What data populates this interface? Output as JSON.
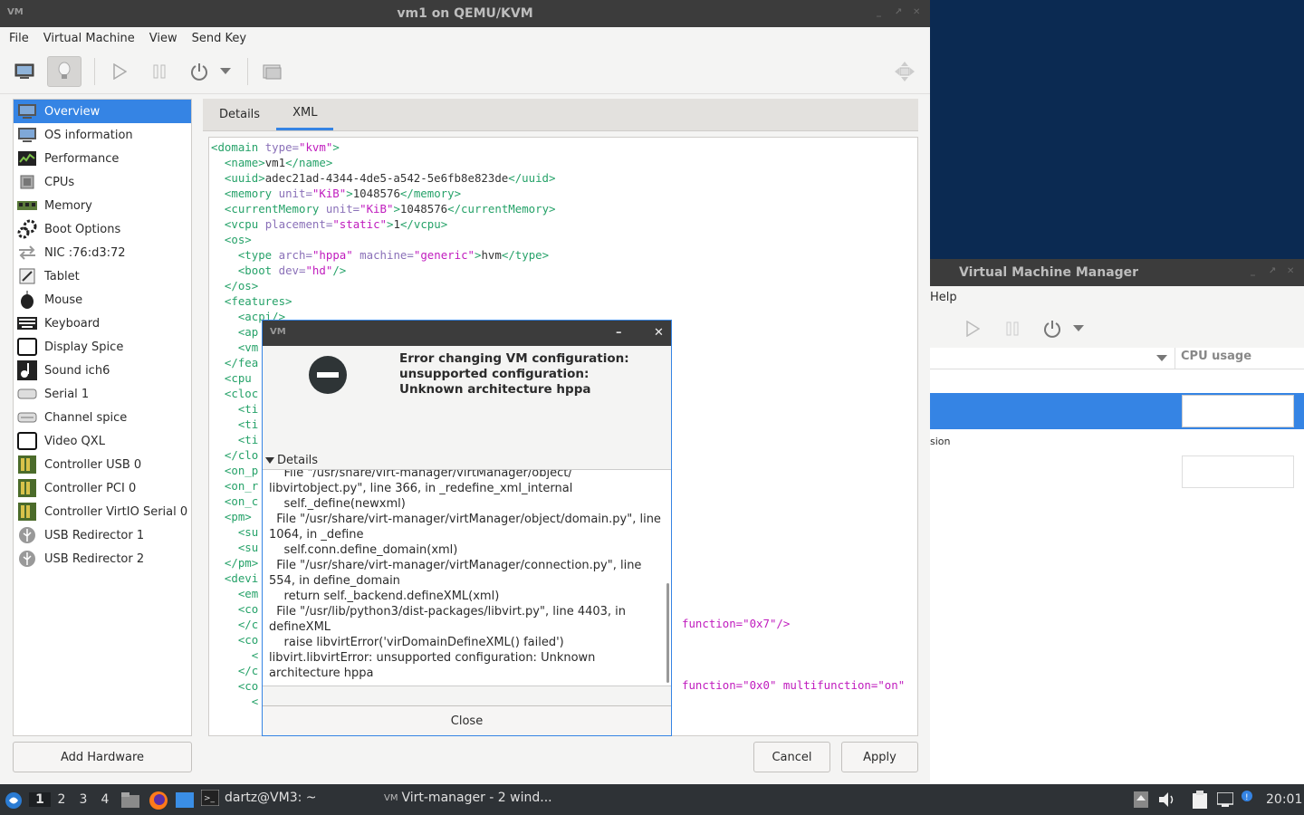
{
  "main_window": {
    "title": "vm1 on QEMU/KVM",
    "menu": [
      "File",
      "Virtual Machine",
      "View",
      "Send Key"
    ],
    "sidebar_items": [
      {
        "label": "Overview",
        "icon": "monitor-icon"
      },
      {
        "label": "OS information",
        "icon": "monitor-icon"
      },
      {
        "label": "Performance",
        "icon": "chart-icon"
      },
      {
        "label": "CPUs",
        "icon": "cpu-icon"
      },
      {
        "label": "Memory",
        "icon": "memory-icon"
      },
      {
        "label": "Boot Options",
        "icon": "gears-icon"
      },
      {
        "label": "NIC :76:d3:72",
        "icon": "network-arrows-icon"
      },
      {
        "label": "Tablet",
        "icon": "tablet-icon"
      },
      {
        "label": "Mouse",
        "icon": "mouse-icon"
      },
      {
        "label": "Keyboard",
        "icon": "keyboard-icon"
      },
      {
        "label": "Display Spice",
        "icon": "display-icon"
      },
      {
        "label": "Sound ich6",
        "icon": "sound-icon"
      },
      {
        "label": "Serial 1",
        "icon": "serial-icon"
      },
      {
        "label": "Channel spice",
        "icon": "channel-icon"
      },
      {
        "label": "Video QXL",
        "icon": "video-icon"
      },
      {
        "label": "Controller USB 0",
        "icon": "controller-icon"
      },
      {
        "label": "Controller PCI 0",
        "icon": "controller-icon"
      },
      {
        "label": "Controller VirtIO Serial 0",
        "icon": "controller-icon"
      },
      {
        "label": "USB Redirector 1",
        "icon": "usb-icon"
      },
      {
        "label": "USB Redirector 2",
        "icon": "usb-icon"
      }
    ],
    "add_hardware": "Add Hardware",
    "tabs": [
      "Details",
      "XML"
    ],
    "cancel": "Cancel",
    "apply": "Apply",
    "xml_right_1": "function=\"0x7\"/>",
    "xml_right_2": "function=\"0x0\" multifunction=\"on\""
  },
  "dialog": {
    "message": "Error changing VM configuration: unsupported configuration: Unknown architecture hppa",
    "details_label": "Details",
    "traceback": [
      "    File \"/usr/share/virt-manager/virtManager/object/",
      "libvirtobject.py\", line 366, in _redefine_xml_internal",
      "    self._define(newxml)",
      "  File \"/usr/share/virt-manager/virtManager/object/domain.py\", line",
      "1064, in _define",
      "    self.conn.define_domain(xml)",
      "  File \"/usr/share/virt-manager/virtManager/connection.py\", line",
      "554, in define_domain",
      "    return self._backend.defineXML(xml)",
      "  File \"/usr/lib/python3/dist-packages/libvirt.py\", line 4403, in",
      "defineXML",
      "    raise libvirtError('virDomainDefineXML() failed')",
      "libvirt.libvirtError: unsupported configuration: Unknown",
      "architecture hppa"
    ],
    "close": "Close"
  },
  "manager_window": {
    "title": "Virtual Machine Manager",
    "menu_help": "Help",
    "cpu_usage": "CPU usage",
    "row_text": "sion"
  },
  "taskbar": {
    "workspaces": [
      "1",
      "2",
      "3",
      "4"
    ],
    "terminal": "dartz@VM3: ~",
    "virt_manager": "Virt-manager - 2 wind...",
    "clock": "20:01"
  },
  "colors": {
    "accent": "#3584e4",
    "titlebar": "#3c3c3c",
    "desktop": "#0b2a52"
  }
}
